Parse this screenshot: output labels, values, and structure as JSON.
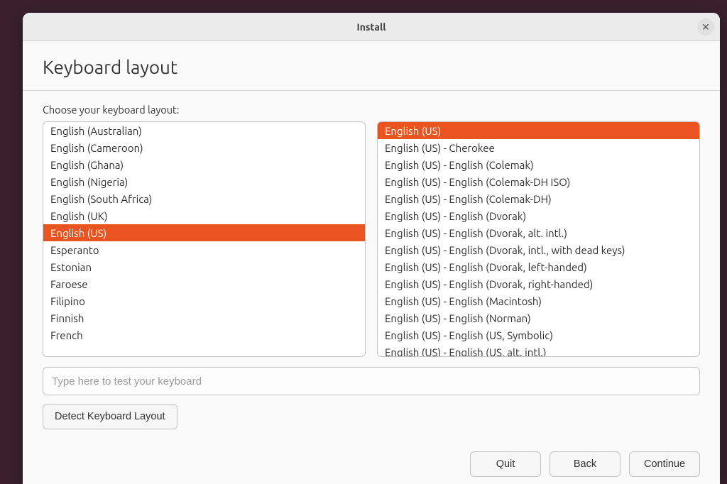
{
  "window": {
    "title": "Install"
  },
  "page": {
    "heading": "Keyboard layout",
    "prompt": "Choose your keyboard layout:"
  },
  "layout_list": {
    "selected_index": 6,
    "items": [
      "English (Australian)",
      "English (Cameroon)",
      "English (Ghana)",
      "English (Nigeria)",
      "English (South Africa)",
      "English (UK)",
      "English (US)",
      "Esperanto",
      "Estonian",
      "Faroese",
      "Filipino",
      "Finnish",
      "French"
    ]
  },
  "variant_list": {
    "selected_index": 0,
    "items": [
      "English (US)",
      "English (US) - Cherokee",
      "English (US) - English (Colemak)",
      "English (US) - English (Colemak-DH ISO)",
      "English (US) - English (Colemak-DH)",
      "English (US) - English (Dvorak)",
      "English (US) - English (Dvorak, alt. intl.)",
      "English (US) - English (Dvorak, intl., with dead keys)",
      "English (US) - English (Dvorak, left-handed)",
      "English (US) - English (Dvorak, right-handed)",
      "English (US) - English (Macintosh)",
      "English (US) - English (Norman)",
      "English (US) - English (US, Symbolic)",
      "English (US) - English (US, alt. intl.)"
    ]
  },
  "test_input": {
    "placeholder": "Type here to test your keyboard"
  },
  "buttons": {
    "detect": "Detect Keyboard Layout",
    "quit": "Quit",
    "back": "Back",
    "continue": "Continue"
  }
}
